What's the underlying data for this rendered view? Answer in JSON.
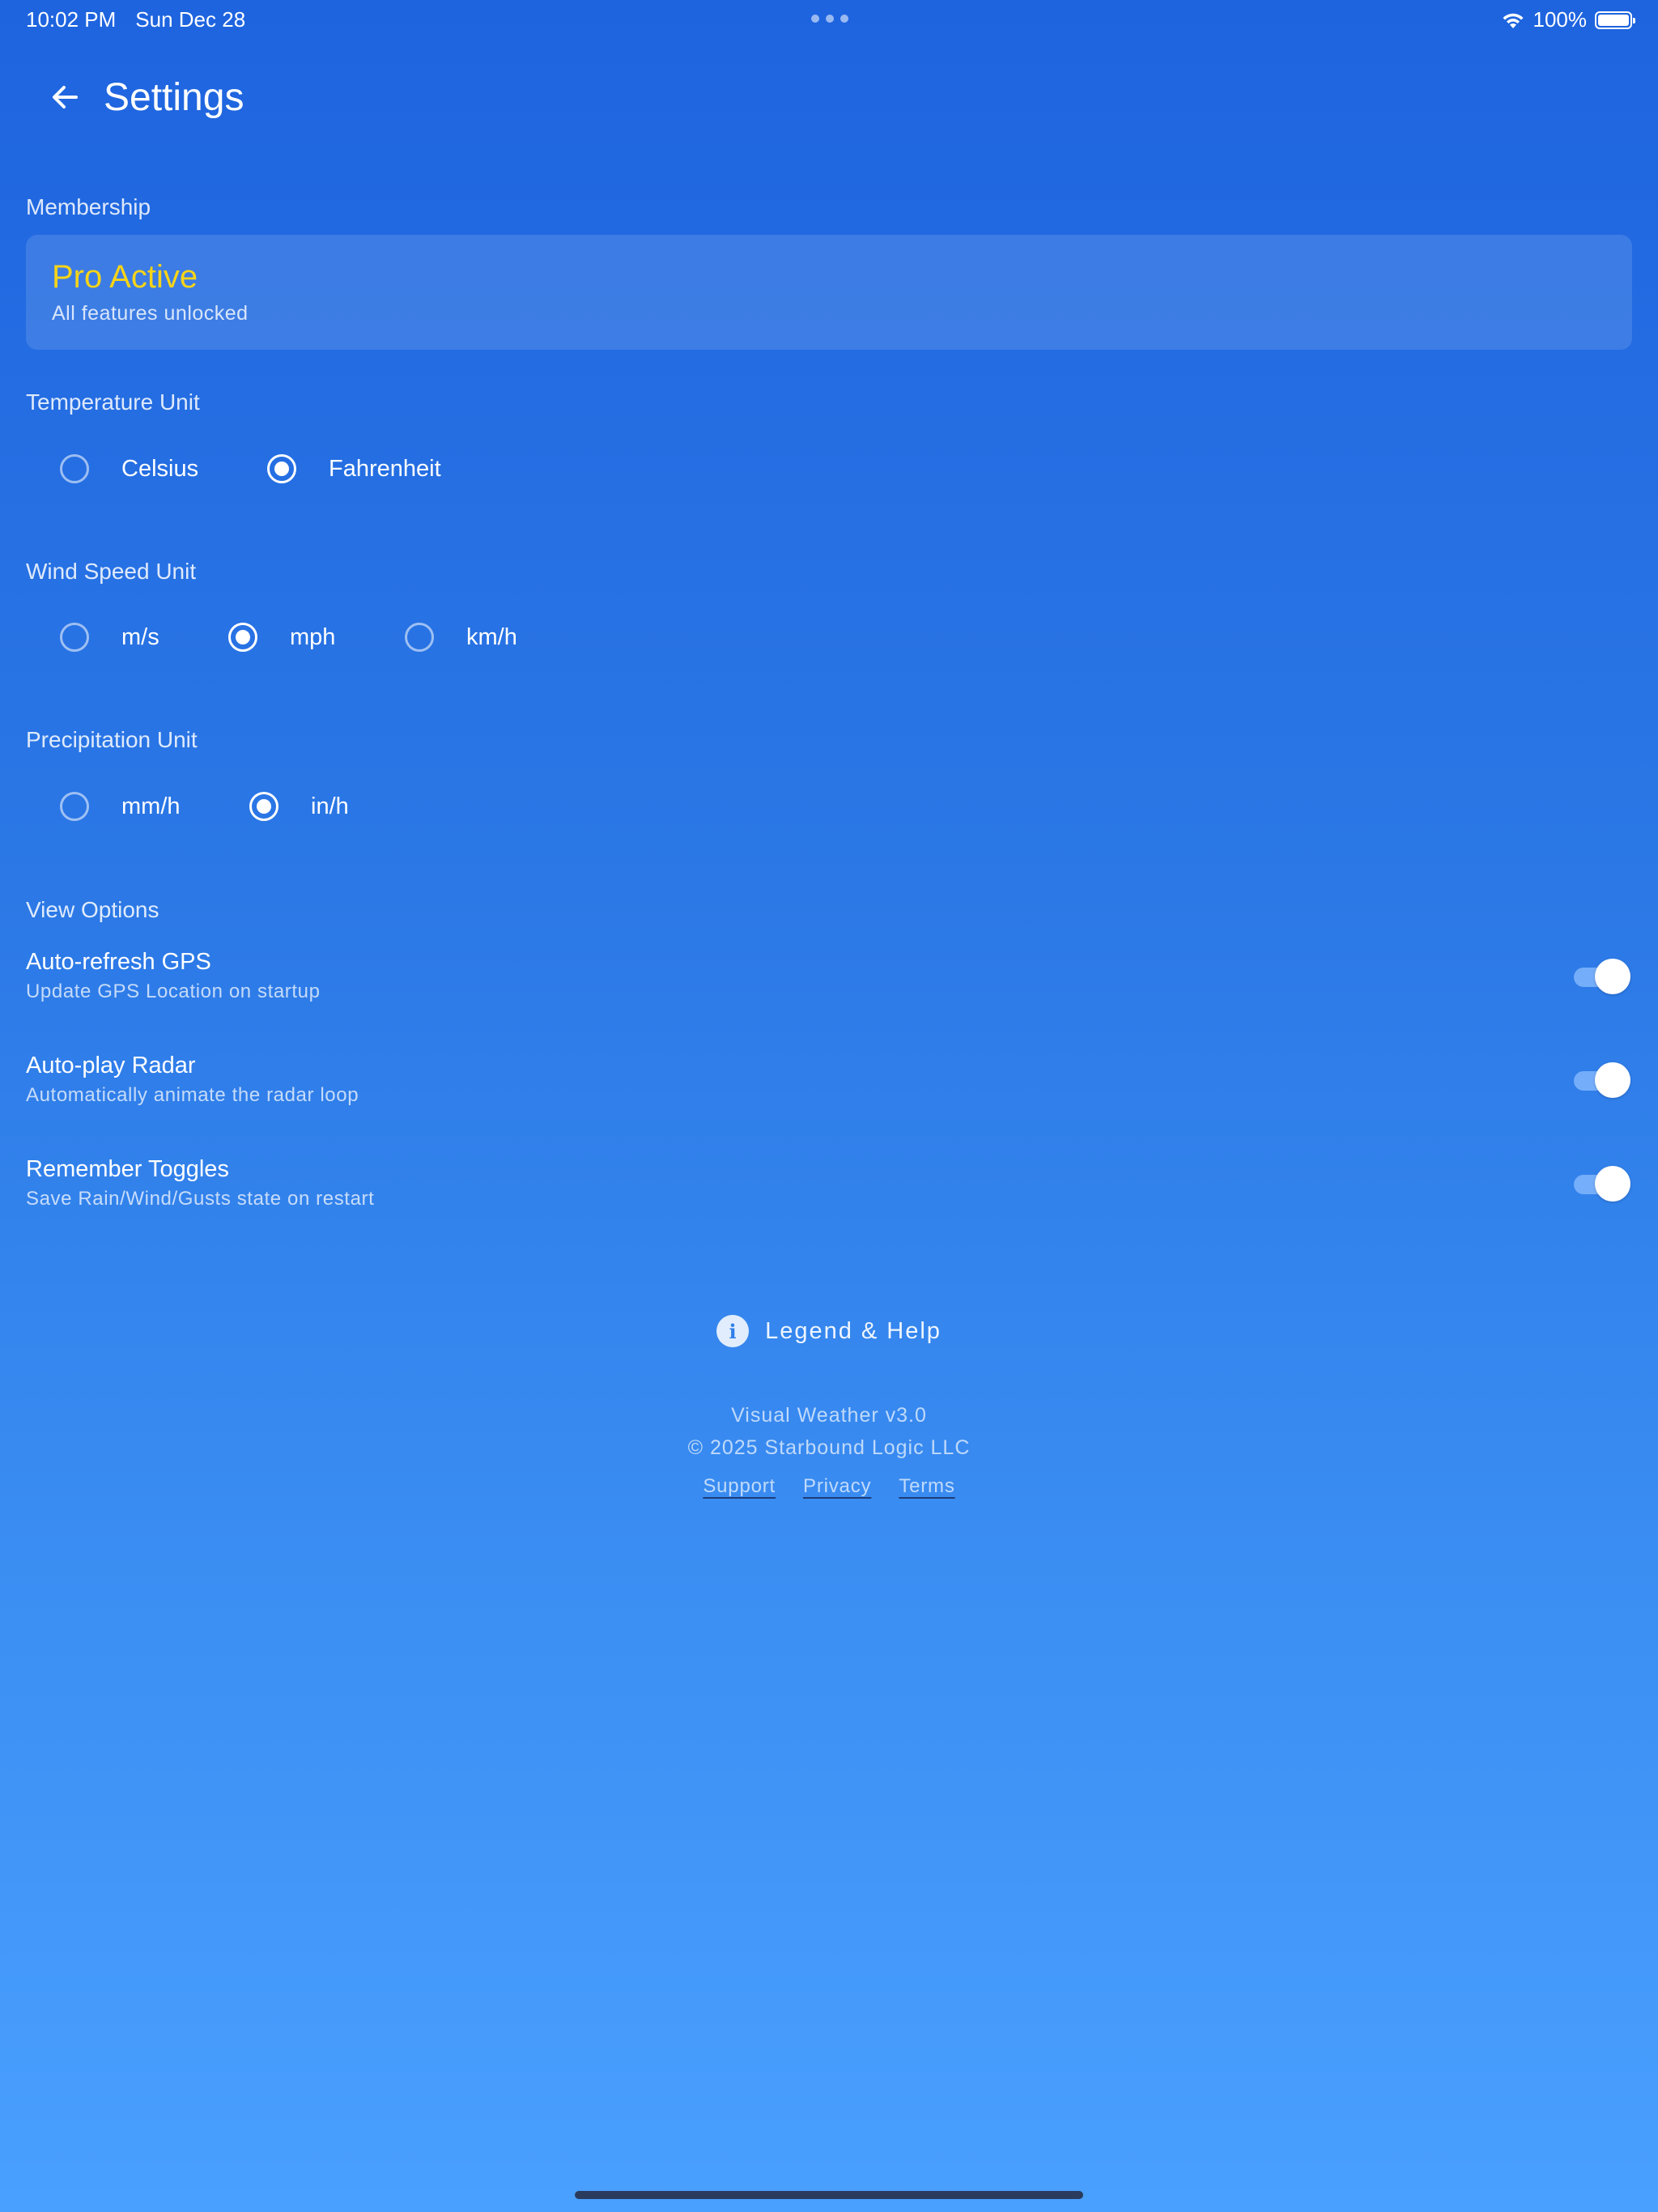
{
  "status_bar": {
    "time": "10:02 PM",
    "date": "Sun Dec 28",
    "battery": "100%"
  },
  "header": {
    "title": "Settings",
    "back_icon": "arrow-left-icon"
  },
  "membership": {
    "section_label": "Membership",
    "status": "Pro Active",
    "description": "All features unlocked",
    "status_color": "#f7d418"
  },
  "temperature_unit": {
    "section_label": "Temperature Unit",
    "options": [
      "Celsius",
      "Fahrenheit"
    ],
    "selected": "Fahrenheit"
  },
  "wind_speed_unit": {
    "section_label": "Wind Speed Unit",
    "options": [
      "m/s",
      "mph",
      "km/h"
    ],
    "selected": "mph"
  },
  "precipitation_unit": {
    "section_label": "Precipitation Unit",
    "options": [
      "mm/h",
      "in/h"
    ],
    "selected": "in/h"
  },
  "view_options": {
    "section_label": "View Options",
    "items": [
      {
        "title": "Auto-refresh GPS",
        "subtitle": "Update GPS Location on startup",
        "enabled": true
      },
      {
        "title": "Auto-play Radar",
        "subtitle": "Automatically animate the radar loop",
        "enabled": true
      },
      {
        "title": "Remember Toggles",
        "subtitle": "Save Rain/Wind/Gusts state on restart",
        "enabled": true
      }
    ]
  },
  "help": {
    "label": "Legend & Help",
    "icon": "info-icon",
    "icon_glyph": "i"
  },
  "footer": {
    "version": "Visual Weather v3.0",
    "copyright": "© 2025 Starbound Logic LLC",
    "links": [
      "Support",
      "Privacy",
      "Terms"
    ]
  },
  "colors": {
    "background_top": "#1e64df",
    "background_bottom": "#4aa0fe",
    "accent_yellow": "#f7d418"
  }
}
